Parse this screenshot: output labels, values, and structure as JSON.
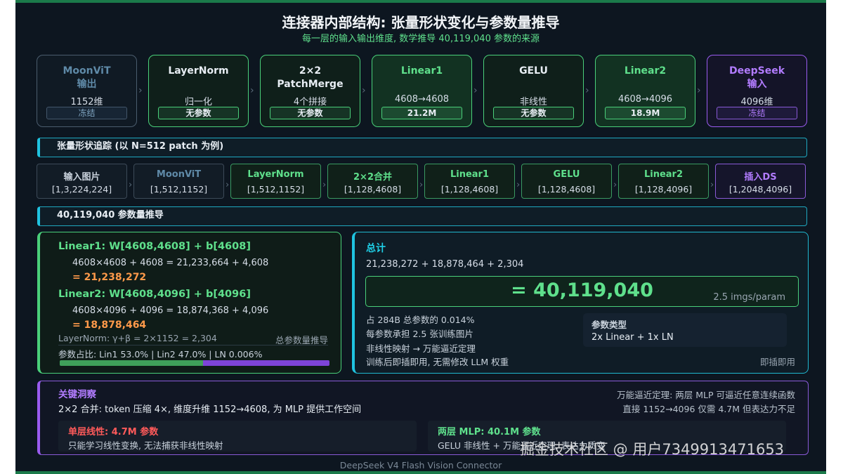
{
  "title": "连接器内部结构: 张量形状变化与参数量推导",
  "subtitle": "每一层的输入输出维度, 数学推导 40,119,040 参数的来源",
  "pipeline": [
    {
      "name": "MoonViT\n输出",
      "dim": "1152维",
      "tag": "冻结",
      "style": "frozen"
    },
    {
      "name": "LayerNorm",
      "dim": "归一化",
      "tag": "无参数",
      "style": "green"
    },
    {
      "name": "2×2\nPatchMerge",
      "dim": "4个拼接",
      "tag": "无参数",
      "style": "green"
    },
    {
      "name": "Linear1",
      "dim": "4608→4608",
      "tag": "21.2M",
      "style": "hi"
    },
    {
      "name": "GELU",
      "dim": "非线性",
      "tag": "无参数",
      "style": "green"
    },
    {
      "name": "Linear2",
      "dim": "4608→4096",
      "tag": "18.9M",
      "style": "hi"
    },
    {
      "name": "DeepSeek\n输入",
      "dim": "4096维",
      "tag": "冻结",
      "style": "purple"
    }
  ],
  "trace_header": "张量形状追踪 (以 N=512 patch 为例)",
  "trace": [
    {
      "name": "输入图片",
      "shape": "[1,3,224,224]",
      "style": "plain"
    },
    {
      "name": "MoonViT",
      "shape": "[1,512,1152]",
      "style": "frozen"
    },
    {
      "name": "LayerNorm",
      "shape": "[1,512,1152]",
      "style": "green"
    },
    {
      "name": "2×2合并",
      "shape": "[1,128,4608]",
      "style": "green"
    },
    {
      "name": "Linear1",
      "shape": "[1,128,4608]",
      "style": "green"
    },
    {
      "name": "GELU",
      "shape": "[1,128,4608]",
      "style": "green"
    },
    {
      "name": "Linear2",
      "shape": "[1,128,4096]",
      "style": "green"
    },
    {
      "name": "插入DS",
      "shape": "[1,2048,4096]",
      "style": "purple"
    }
  ],
  "deriv_header": "40,119,040 参数量推导",
  "left": {
    "l1_head": "Linear1: W[4608,4608] + b[4608]",
    "l1_formula": "4608×4608 + 4608 = 21,233,664 + 4,608",
    "l1_result": "= 21,238,272",
    "l2_head": "Linear2: W[4608,4096] + b[4096]",
    "l2_formula": "4608×4096 + 4096 = 18,874,368 + 4,096",
    "l2_result": "= 18,878,464",
    "ln_line": "LayerNorm: γ+β = 2×1152 = 2,304",
    "ln_note": "总参数量推导",
    "ratio": "参数占比: Lin1 53.0% | Lin2 47.0% | LN 0.006%",
    "share_lin1": 0.53
  },
  "right": {
    "head": "总计",
    "sum": "21,238,272 + 18,878,464 + 2,304",
    "total": "= 40,119,040",
    "per_param": "2.5 imgs/param",
    "notes": [
      "占 284B 总参数的 0.014%",
      "每参数承担 2.5 张训练图片",
      "非线性映射 → 万能逼近定理",
      "训练后即插即用, 无需修改 LLM 权重"
    ],
    "type_head": "参数类型",
    "type_val": "2x Linear + 1x LN",
    "plug": "即插即用"
  },
  "insight": {
    "head": "关键洞察",
    "line": "2×2 合并: token 压缩 4×, 维度升维 1152→4608, 为 MLP 提供工作空间",
    "r1": "万能逼近定理: 两层 MLP 可逼近任意连续函数",
    "r2": "直接 1152→4096 仅需 4.7M 但表达力不足",
    "a_head": "单层线性: 4.7M 参数",
    "a_text": "只能学习线性变换, 无法捕获非线性映射",
    "b_head": "两层 MLP: 40.1M 参数",
    "b_text": "GELU 非线性 + 万能逼近定理, 表达力质变"
  },
  "footer": "DeepSeek V4 Flash Vision Connector",
  "watermark": "掘金技术社区 @ 用户7349913471653"
}
